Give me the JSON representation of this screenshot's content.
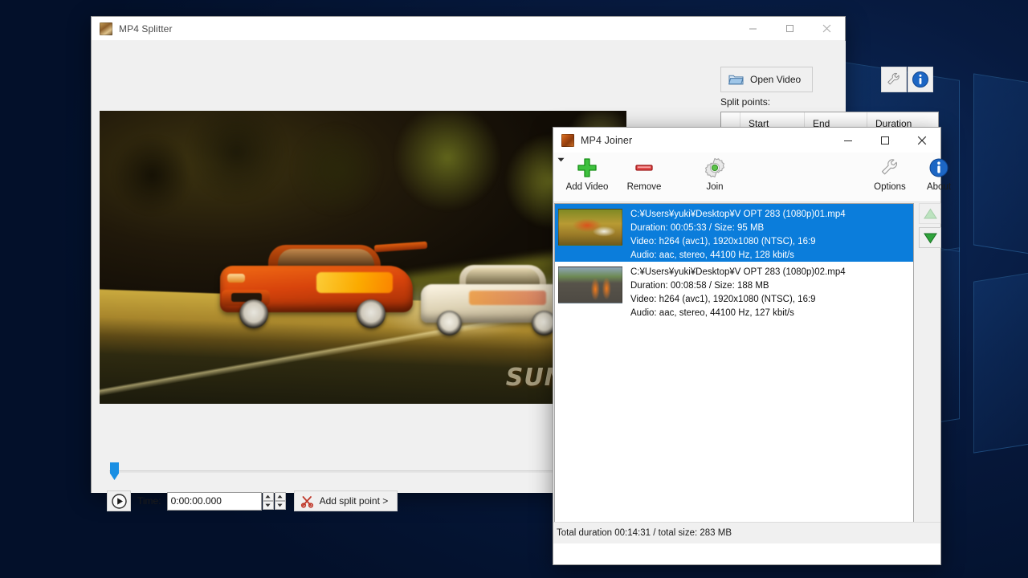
{
  "desktop": {
    "wallpaper_name": "windows-hero-logo"
  },
  "splitter": {
    "title": "MP4 Splitter",
    "app_icon": "mp4-splitter-icon",
    "window_buttons": {
      "minimize": "minimize-icon",
      "maximize": "maximize-icon",
      "close": "close-icon"
    },
    "open_video_label": "Open Video",
    "options_icon": "wrench-icon",
    "about_icon": "info-icon",
    "split_points_label": "Split points:",
    "split_points_columns": [
      "",
      "Start",
      "End",
      "Duration"
    ],
    "split_points_rows": [],
    "transport": {
      "play_icon": "play-icon",
      "time_label": "Time:",
      "time_value": "0:00:00.000",
      "time_placeholder": "0:00:00.000",
      "add_split_label": "Add split point >",
      "scissors_icon": "scissors-icon",
      "timeline_position_percent": 0
    },
    "preview": {
      "watermark": "SUNPROS"
    }
  },
  "joiner": {
    "title": "MP4 Joiner",
    "app_icon": "mp4-joiner-icon",
    "window_buttons": {
      "minimize": "minimize-icon",
      "maximize": "maximize-icon",
      "close": "close-icon"
    },
    "toolbar": [
      {
        "id": "add-video",
        "label": "Add Video",
        "icon": "plus-icon"
      },
      {
        "id": "remove",
        "label": "Remove",
        "icon": "minus-icon"
      },
      {
        "id": "remove-dropdown",
        "label": "",
        "icon": "chevron-down-icon"
      },
      {
        "id": "join",
        "label": "Join",
        "icon": "gear-icon"
      },
      {
        "id": "options",
        "label": "Options",
        "icon": "wrench-icon"
      },
      {
        "id": "about",
        "label": "About",
        "icon": "info-icon"
      }
    ],
    "files": [
      {
        "path": "C:¥Users¥yuki¥Desktop¥V OPT 283 (1080p)01.mp4",
        "duration_size": "Duration: 00:05:33 / Size: 95 MB",
        "video": "Video: h264 (avc1), 1920x1080 (NTSC), 16:9",
        "audio": "Audio: aac, stereo, 44100 Hz, 128 kbit/s",
        "selected": true
      },
      {
        "path": "C:¥Users¥yuki¥Desktop¥V OPT 283 (1080p)02.mp4",
        "duration_size": "Duration: 00:08:58 / Size: 188 MB",
        "video": "Video: h264 (avc1), 1920x1080 (NTSC), 16:9",
        "audio": "Audio: aac, stereo, 44100 Hz, 127 kbit/s",
        "selected": false
      }
    ],
    "side_buttons": [
      {
        "id": "move-up",
        "icon": "triangle-up-icon",
        "enabled": false
      },
      {
        "id": "move-down",
        "icon": "triangle-down-icon",
        "enabled": true
      }
    ],
    "status": "Total duration 00:14:31 / total size: 283 MB"
  },
  "colors": {
    "selection_blue": "#0b7ddb",
    "accent_green": "#22a12a",
    "accent_red": "#cc2222",
    "info_blue": "#1c66c4",
    "desktop_navy": "#05173a"
  }
}
